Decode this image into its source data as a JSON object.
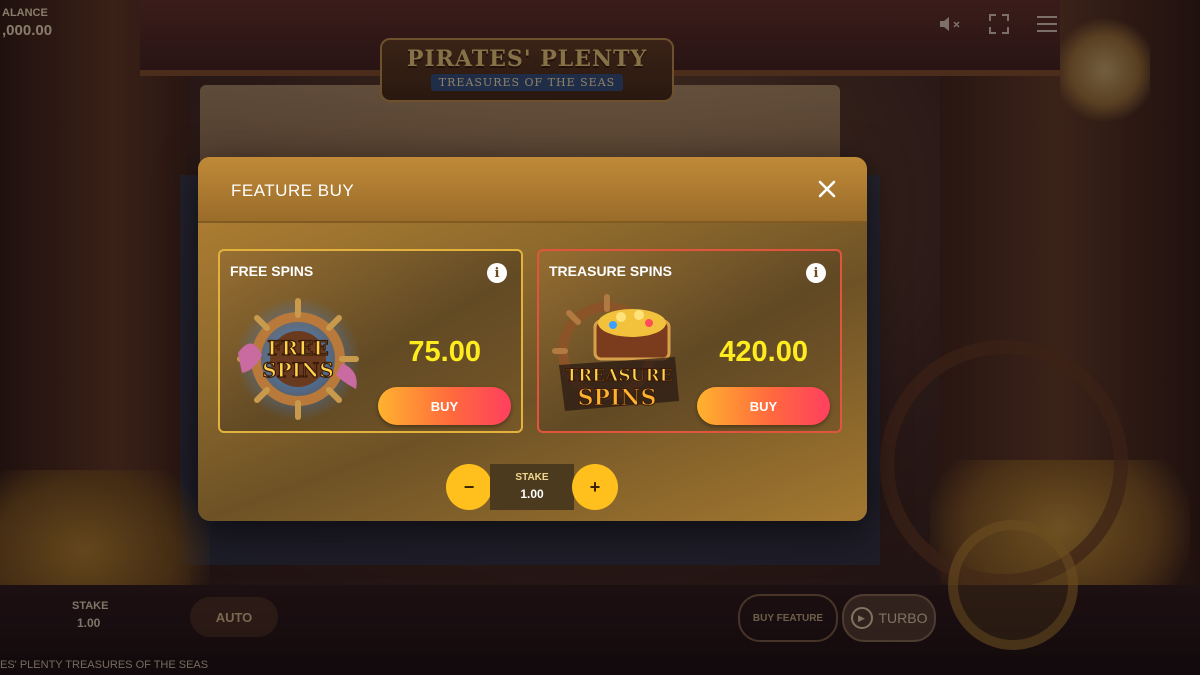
{
  "game": {
    "logo_line1": "PIRATES' PLENTY",
    "logo_line2": "TREASURES OF THE SEAS",
    "footer_title": "ES' PLENTY TREASURES OF THE SEAS"
  },
  "hud": {
    "balance_label": "ALANCE",
    "balance_value": ",000.00",
    "stake_label": "STAKE",
    "stake_value": "1.00",
    "auto_label": "AUTO",
    "buy_feature_label": "BUY FEATURE",
    "turbo_label": "TURBO",
    "icons": [
      "sound-muted-icon",
      "fullscreen-icon",
      "menu-icon"
    ]
  },
  "modal": {
    "title": "FEATURE BUY",
    "cards": [
      {
        "title": "FREE SPINS",
        "price": "75.00",
        "buy_label": "BUY",
        "icon": "free-spins-emblem",
        "art_text1": "FREE",
        "art_text2": "SPINS"
      },
      {
        "title": "TREASURE SPINS",
        "price": "420.00",
        "buy_label": "BUY",
        "icon": "treasure-spins-emblem",
        "art_text1": "TREASURE",
        "art_text2": "SPINS"
      }
    ],
    "stake": {
      "label": "STAKE",
      "value": "1.00",
      "minus": "−",
      "plus": "+"
    }
  },
  "colors": {
    "price": "#ffec1f",
    "buy_gradient_start": "#ffb22e",
    "buy_gradient_end": "#ff3f5f",
    "stake_buttons": "#ffc01e",
    "free_spins_border": "#e2b23c",
    "treasure_spins_border": "#e0563c"
  }
}
